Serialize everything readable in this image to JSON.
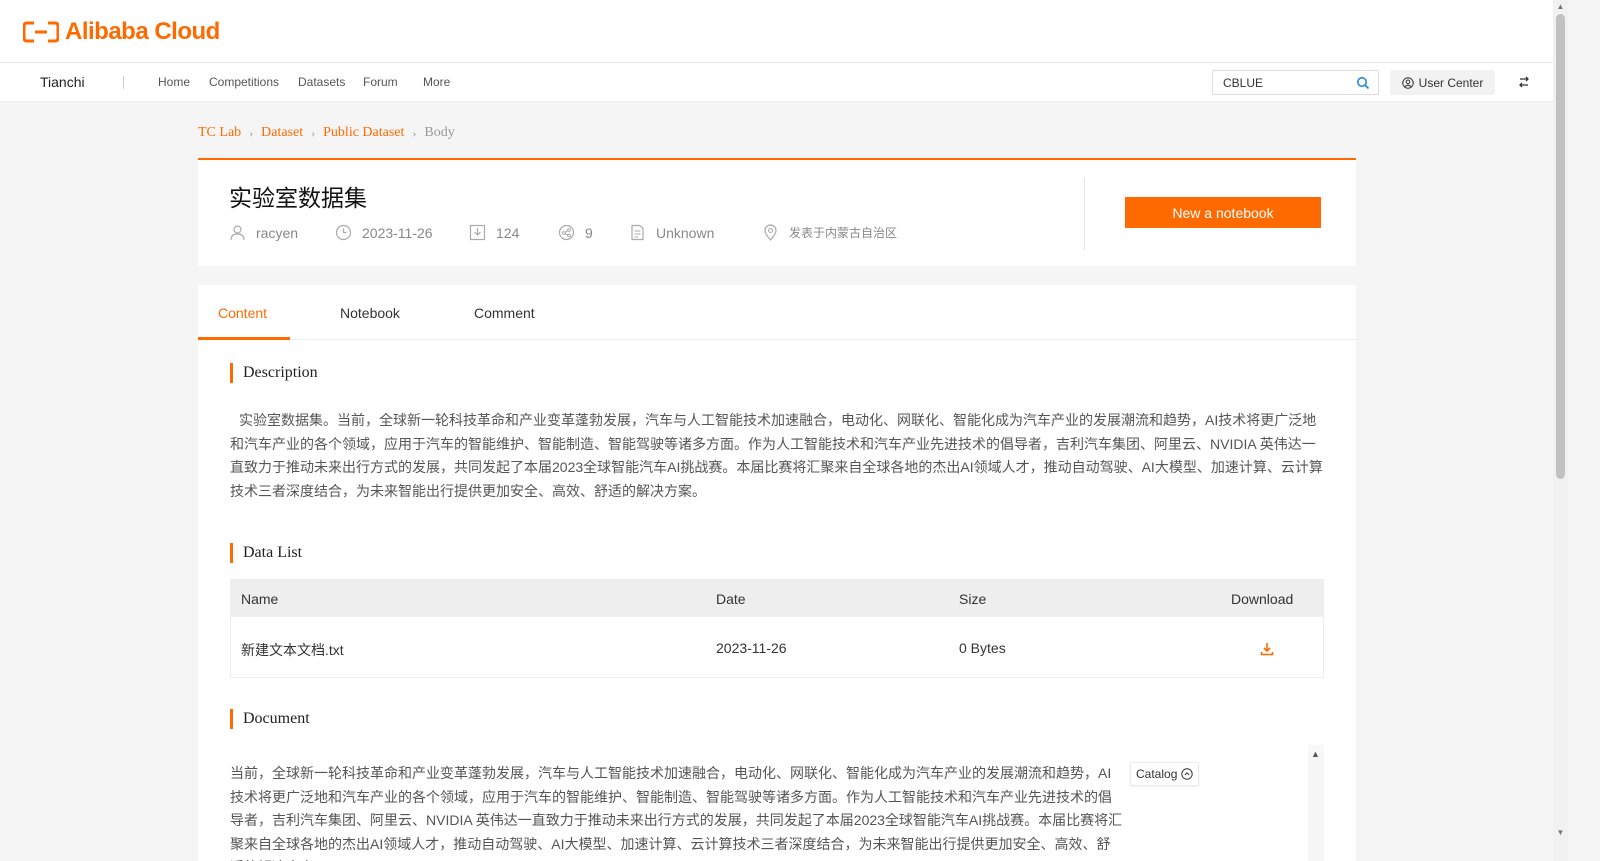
{
  "brand": {
    "logo_text": "Alibaba Cloud"
  },
  "nav": {
    "brand": "Tianchi",
    "items": [
      "Home",
      "Competitions",
      "Datasets",
      "Forum",
      "More"
    ],
    "search_value": "CBLUE",
    "user_center": "User Center"
  },
  "breadcrumb": [
    "TC Lab",
    "Dataset",
    "Public Dataset",
    "Body"
  ],
  "dataset": {
    "title": "实验室数据集",
    "author": "racyen",
    "date": "2023-11-26",
    "downloads": "124",
    "forks": "9",
    "license": "Unknown",
    "location": "发表于内蒙古自治区",
    "new_notebook": "New a notebook"
  },
  "tabs": [
    "Content",
    "Notebook",
    "Comment"
  ],
  "sections": {
    "description_title": "Description",
    "description": "实验室数据集。当前，全球新一轮科技革命和产业变革蓬勃发展，汽车与人工智能技术加速融合，电动化、网联化、智能化成为汽车产业的发展潮流和趋势，AI技术将更广泛地和汽车产业的各个领域，应用于汽车的智能维护、智能制造、智能驾驶等诸多方面。作为人工智能技术和汽车产业先进技术的倡导者，吉利汽车集团、阿里云、NVIDIA 英伟达一直致力于推动未来出行方式的发展，共同发起了本届2023全球智能汽车AI挑战赛。本届比赛将汇聚来自全球各地的杰出AI领域人才，推动自动驾驶、AI大模型、加速计算、云计算技术三者深度结合，为未来智能出行提供更加安全、高效、舒适的解决方案。",
    "datalist_title": "Data List",
    "document_title": "Document",
    "document": "当前，全球新一轮科技革命和产业变革蓬勃发展，汽车与人工智能技术加速融合，电动化、网联化、智能化成为汽车产业的发展潮流和趋势，AI技术将更广泛地和汽车产业的各个领域，应用于汽车的智能维护、智能制造、智能驾驶等诸多方面。作为人工智能技术和汽车产业先进技术的倡导者，吉利汽车集团、阿里云、NVIDIA 英伟达一直致力于推动未来出行方式的发展，共同发起了本届2023全球智能汽车AI挑战赛。本届比赛将汇聚来自全球各地的杰出AI领域人才，推动自动驾驶、AI大模型、加速计算、云计算技术三者深度结合，为未来智能出行提供更加安全、高效、舒适的解决方案。",
    "catalog": "Catalog"
  },
  "table": {
    "headers": [
      "Name",
      "Date",
      "Size",
      "Download"
    ],
    "rows": [
      {
        "name": "新建文本文档.txt",
        "date": "2023-11-26",
        "size": "0 Bytes"
      }
    ]
  },
  "colors": {
    "accent": "#ff6a00"
  }
}
